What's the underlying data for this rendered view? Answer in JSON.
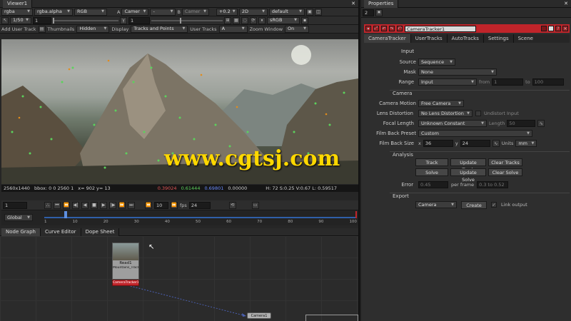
{
  "viewer": {
    "tab": "Viewer1",
    "row1": {
      "channels": "rgba",
      "alpha": "rgba.alpha",
      "rgb": "RGB",
      "a_label": "A",
      "input_a": "Camer",
      "a_dash": "-",
      "b_label": "B",
      "input_b": "Camer",
      "gain": "+0.2",
      "mode": "2D",
      "proxy": "default"
    },
    "row2": {
      "frame_range": "1/50",
      "gain_value": "1",
      "gamma_value": "1",
      "colorspace": "sRGB"
    },
    "row3": {
      "add_label": "Add User Track",
      "thumbnails_label": "Thumbnails",
      "thumbnails_value": "Hidden",
      "display_label": "Display",
      "display_value": "Tracks and Points",
      "user_tracks_label": "User Tracks",
      "user_tracks_value": "A",
      "zoom_label": "Zoom Window",
      "zoom_value": "On"
    },
    "status": {
      "format": "2560x1440",
      "bbox": "bbox: 0 0 2560 1",
      "x": "x= 902 y= 13",
      "r": "0.39024",
      "g": "0.61444",
      "b": "0.69801",
      "a": "0.00000",
      "hsv": "H: 72 S:0.25 V:0.67 L: 0.59517"
    },
    "controls": {
      "frame": "1",
      "step": "10",
      "fps_label": "fps",
      "fps": "24",
      "scope": "Global"
    },
    "timeline": {
      "ticks": [
        "1",
        "10",
        "20",
        "30",
        "40",
        "50",
        "60",
        "70",
        "80",
        "90",
        "100"
      ]
    }
  },
  "nodegraph": {
    "tabs": [
      "Node Graph",
      "Curve Editor",
      "Dope Sheet"
    ],
    "read_node": "Read1",
    "read_file": "Mountains_Track_Scene.mov",
    "tracker_node": "CameraTracker1",
    "camera_node": "Camera1"
  },
  "properties": {
    "tab": "Properties",
    "count": "2",
    "node_name": "CameraTracker1",
    "tabs": [
      "CameraTracker",
      "UserTracks",
      "AutoTracks",
      "Settings",
      "Scene"
    ],
    "input_header": "Input",
    "source_label": "Source",
    "source_value": "Sequence",
    "mask_label": "Mask",
    "mask_value": "None",
    "range_label": "Range",
    "range_value": "Input",
    "range_from_label": "from",
    "range_from": "1",
    "range_to_label": "to",
    "range_to": "100",
    "camera_header": "Camera",
    "motion_label": "Camera Motion",
    "motion_value": "Free Camera",
    "lens_label": "Lens Distortion",
    "lens_value": "No Lens Distortion",
    "undistort_label": "Undistort Input",
    "focal_label": "Focal Length",
    "focal_value": "Unknown Constant",
    "length_label": "Length",
    "length_value": "50",
    "film_label": "Film Back Preset",
    "film_value": "Custom",
    "filmsize_label": "Film Back Size",
    "x_label": "x",
    "film_x": "36",
    "y_label": "y",
    "film_y": "24",
    "units_label": "Units",
    "units_value": "mm",
    "analysis_header": "Analysis",
    "buttons": {
      "track": "Track",
      "update_track": "Update Track",
      "clear_tracks": "Clear Tracks",
      "solve": "Solve",
      "update_solve": "Update Solve",
      "clear_solve": "Clear Solve"
    },
    "error_label": "Error",
    "error_value": "0.45",
    "per_frame_label": "per frame",
    "per_frame_value": "0.3 to 0.52",
    "export_header": "Export",
    "export_value": "Camera",
    "create_label": "Create",
    "link_label": "Link output"
  },
  "colors": {
    "panel": "#2d2d2d",
    "accent_red": "#c0242a",
    "hud_green": "#5cd25c",
    "orange": "#e28c1c",
    "watermark": "#ffd800"
  },
  "watermark": "www.cgtsj.com"
}
